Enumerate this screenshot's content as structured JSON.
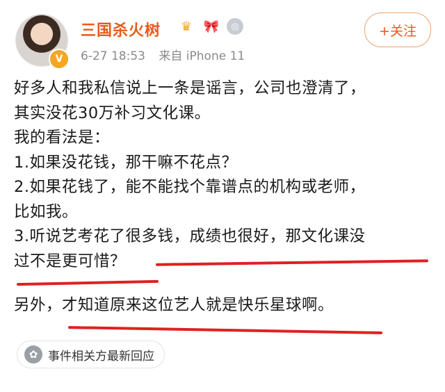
{
  "post": {
    "author": {
      "name": "三国杀火树",
      "avatar_badge": "V",
      "badges": [
        "crown-icon",
        "ribbon-icon",
        "medal-icon"
      ]
    },
    "meta": {
      "date": "6-27 18:53",
      "source": "来自 iPhone 11"
    },
    "follow_label": "+关注",
    "lines": [
      "好多人和我私信说上一条是谣言，公司也澄清了，",
      "其实没花30万补习文化课。",
      "我的看法是：",
      "1.如果没花钱，那干嘛不花点？",
      "2.如果花钱了，能不能找个靠谱点的机构或老师，",
      "比如我。",
      "3.听说艺考花了很多钱，成绩也很好，那文化课没",
      "过不是更可惜？"
    ],
    "extra_line": "另外，才知道原来这位艺人就是快乐星球啊。",
    "event_label": "事件相关方最新回应"
  },
  "colors": {
    "accent": "#e8591b",
    "underline": "#e02020"
  }
}
